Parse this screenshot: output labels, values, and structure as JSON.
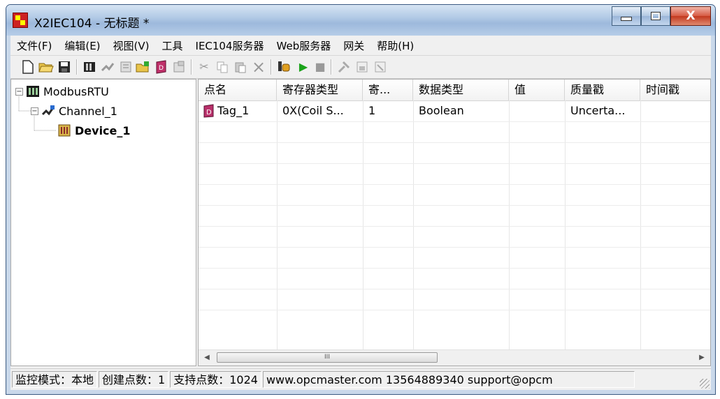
{
  "window": {
    "title": "X2IEC104 - 无标题 *",
    "minimize_icon": "minimize-icon",
    "maximize_icon": "maximize-icon",
    "close_glyph": "X"
  },
  "menu": [
    "文件(F)",
    "编辑(E)",
    "视图(V)",
    "工具",
    "IEC104服务器",
    "Web服务器",
    "网关",
    "帮助(H)"
  ],
  "toolbar": {
    "icons": [
      "new-file-icon",
      "open-folder-icon",
      "save-icon",
      "add-channel-icon",
      "add-device-icon",
      "device-props-icon",
      "new-tag-icon",
      "add-tag-icon",
      "tag-props-icon",
      "cut-icon",
      "copy-icon",
      "paste-icon",
      "delete-icon",
      "monitor-icon",
      "run-icon",
      "stop-icon",
      "tool-icon",
      "load-icon",
      "unload-icon"
    ],
    "glyphs": {
      "cut": "✂",
      "delete": "×",
      "run": "▶",
      "stop": "■"
    }
  },
  "tree": {
    "root": {
      "label": "ModbusRTU",
      "expander": "−"
    },
    "channel": {
      "label": "Channel_1",
      "expander": "−"
    },
    "device": {
      "label": "Device_1"
    }
  },
  "table": {
    "columns": [
      "点名",
      "寄存器类型",
      "寄...",
      "数据类型",
      "值",
      "质量戳",
      "时间戳"
    ],
    "rows": [
      {
        "name": "Tag_1",
        "register_type": "0X(Coil S...",
        "address": "1",
        "data_type": "Boolean",
        "value": "",
        "quality": "Uncerta...",
        "timestamp": ""
      }
    ],
    "scroll_thumb": "III"
  },
  "status": {
    "mode": "监控模式：本地",
    "created": "创建点数：1",
    "supported": "支持点数：1024",
    "contact": "www.opcmaster.com 13564889340 support@opcm"
  },
  "colors": {
    "title_gradient": "#b3cbe6",
    "close": "#c2391f",
    "run": "#1aa31a"
  }
}
